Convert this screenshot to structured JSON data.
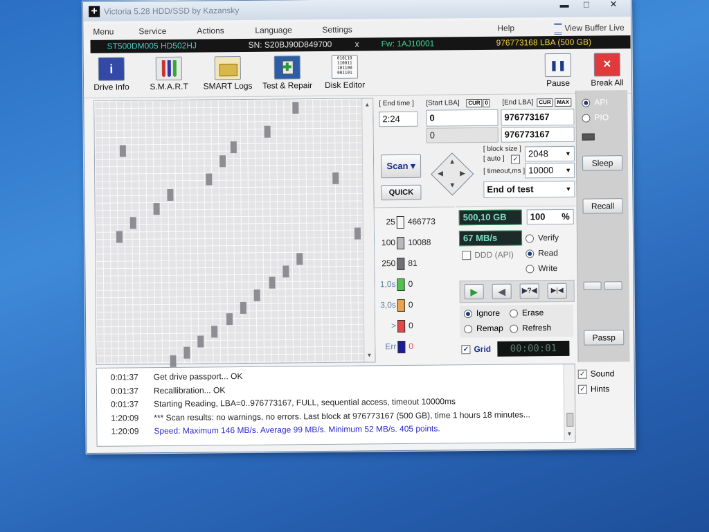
{
  "window": {
    "title": "Victoria 5.28 HDD/SSD by Kazansky",
    "controls": {
      "minimize": "▬",
      "maximize": "□",
      "close": "✕"
    }
  },
  "menu": {
    "items": [
      "Menu",
      "Service",
      "Actions",
      "Language",
      "Settings",
      "Help"
    ],
    "view_buffer": "View Buffer Live"
  },
  "drive": {
    "model": "ST500DM005 HD502HJ",
    "serial": "SN: S20BJ90D849700",
    "sep": "x",
    "firmware": "Fw: 1AJ10001",
    "capacity": "976773168 LBA (500 GB)"
  },
  "toolbar": {
    "drive_info": "Drive Info",
    "smart": "S.M.A.R.T",
    "smart_logs": "SMART Logs",
    "test_repair": "Test & Repair",
    "disk_editor": "Disk Editor",
    "pause": "Pause",
    "break_all": "Break All"
  },
  "scan": {
    "end_time_label": "[ End time ]",
    "end_time_value": "2:24",
    "start_lba_label": "[Start LBA]",
    "cur_tag": "CUR",
    "zero_tag": "0",
    "start_lba_value": "0",
    "start_lba_value2": "0",
    "end_lba_label": "[End LBA]",
    "max_tag": "MAX",
    "end_lba_value": "976773167",
    "end_lba_value2": "976773167",
    "block_size_label": "[ block size ]",
    "block_size_value": "2048",
    "auto_label": "[ auto ]",
    "timeout_label": "[ timeout,ms ]",
    "timeout_value": "10000",
    "scan_button": "Scan",
    "quick_button": "QUICK",
    "end_action": "End of test"
  },
  "legend": [
    {
      "label": "25",
      "count": "466773",
      "color": "#f6f6f6"
    },
    {
      "label": "100",
      "count": "10088",
      "color": "#b8b8bc"
    },
    {
      "label": "250",
      "count": "81",
      "color": "#6f6f78"
    },
    {
      "label": "1,0s",
      "count": "0",
      "color": "#4fc34f"
    },
    {
      "label": "3,0s",
      "count": "0",
      "color": "#e9a44a"
    },
    {
      "label": ">",
      "count": "0",
      "color": "#e04a4a"
    },
    {
      "label": "Err",
      "count": "0",
      "color": "#1a1a9a"
    }
  ],
  "status": {
    "size": "500,10 GB",
    "percent": "100",
    "percent_unit": "%",
    "speed": "67 MB/s",
    "ddd": "DDD (API)",
    "mode_verify": "Verify",
    "mode_read": "Read",
    "mode_write": "Write",
    "action_ignore": "Ignore",
    "action_erase": "Erase",
    "action_remap": "Remap",
    "action_refresh": "Refresh",
    "grid_label": "Grid",
    "timer": "00:00:01"
  },
  "side": {
    "api": "API",
    "pio": "PIO",
    "sleep": "Sleep",
    "recall": "Recall",
    "passp": "Passp",
    "sound": "Sound",
    "hints": "Hints"
  },
  "log": [
    {
      "time": "0:01:37",
      "msg": "Get drive passport... OK"
    },
    {
      "time": "0:01:37",
      "msg": "Recallibration... OK"
    },
    {
      "time": "0:01:37",
      "msg": "Starting Reading, LBA=0..976773167, FULL, sequential access, timeout 10000ms"
    },
    {
      "time": "1:20:09",
      "msg": "*** Scan results: no warnings, no errors. Last block at 976773167 (500 GB), time 1 hours 18 minutes..."
    },
    {
      "time": "1:20:09",
      "msg": "Speed: Maximum 146 MB/s. Average 99 MB/s. Minimum 52 MB/s. 405 points."
    }
  ],
  "colors": {
    "info_model": "#35d0c0",
    "info_serial": "#e6e6e6",
    "info_firmware": "#3fd39a",
    "info_capacity": "#f2d14a",
    "log_highlight": "#2a2ad0"
  }
}
